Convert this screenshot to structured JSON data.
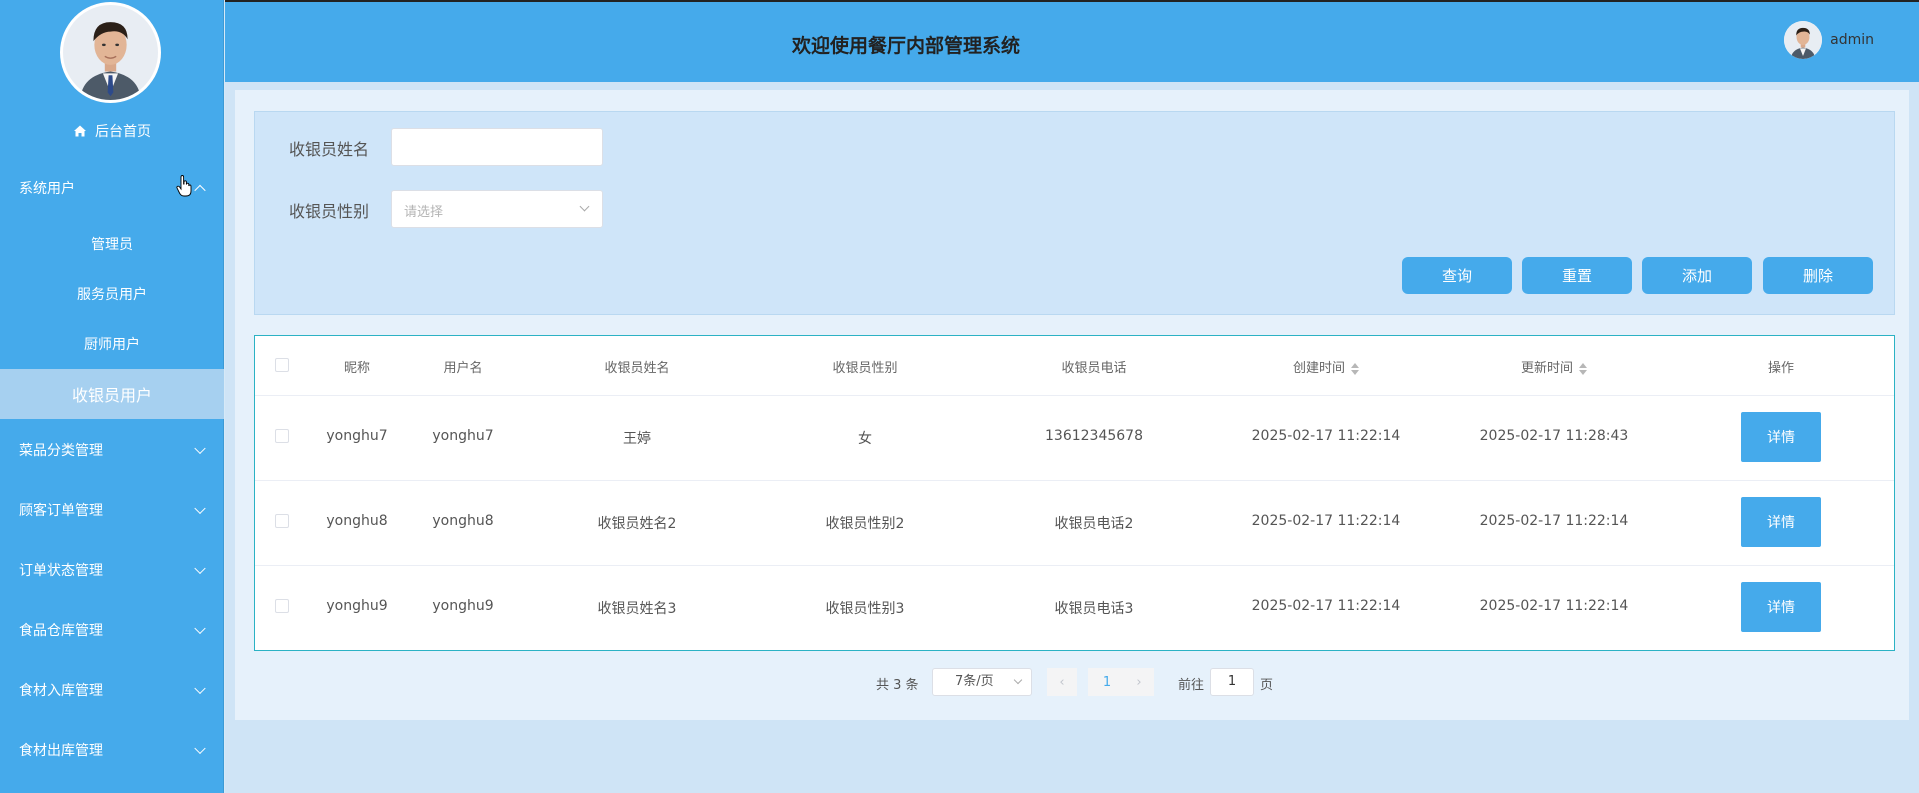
{
  "sidebar": {
    "home_label": "后台首页",
    "system_users_label": "系统用户",
    "sub_items": [
      "管理员",
      "服务员用户",
      "厨师用户",
      "收银员用户"
    ],
    "active_sub_item": "收银员用户",
    "menus": [
      "菜品分类管理",
      "顾客订单管理",
      "订单状态管理",
      "食品仓库管理",
      "食材入库管理",
      "食材出库管理"
    ]
  },
  "header": {
    "title": "欢迎使用餐厅内部管理系统",
    "username": "admin"
  },
  "search": {
    "name_label": "收银员姓名",
    "name_value": "",
    "gender_label": "收银员性别",
    "gender_placeholder": "请选择",
    "buttons": {
      "query": "查询",
      "reset": "重置",
      "add": "添加",
      "delete": "删除"
    }
  },
  "table": {
    "headers": [
      "昵称",
      "用户名",
      "收银员姓名",
      "收银员性别",
      "收银员电话",
      "创建时间",
      "更新时间",
      "操作"
    ],
    "rows": [
      {
        "nickname": "yonghu7",
        "username": "yonghu7",
        "name": "王婷",
        "gender": "女",
        "phone": "13612345678",
        "created": "2025-02-17 11:22:14",
        "updated": "2025-02-17 11:28:43",
        "action": "详情"
      },
      {
        "nickname": "yonghu8",
        "username": "yonghu8",
        "name": "收银员姓名2",
        "gender": "收银员性别2",
        "phone": "收银员电话2",
        "created": "2025-02-17 11:22:14",
        "updated": "2025-02-17 11:22:14",
        "action": "详情"
      },
      {
        "nickname": "yonghu9",
        "username": "yonghu9",
        "name": "收银员姓名3",
        "gender": "收银员性别3",
        "phone": "收银员电话3",
        "created": "2025-02-17 11:22:14",
        "updated": "2025-02-17 11:22:14",
        "action": "详情"
      }
    ]
  },
  "pagination": {
    "total_text": "共 3 条",
    "page_size": "7条/页",
    "current_page": "1",
    "goto_label": "前往",
    "goto_value": "1",
    "page_suffix": "页"
  },
  "colors": {
    "primary": "#45aaeb",
    "table_border": "#2bb2c4"
  }
}
